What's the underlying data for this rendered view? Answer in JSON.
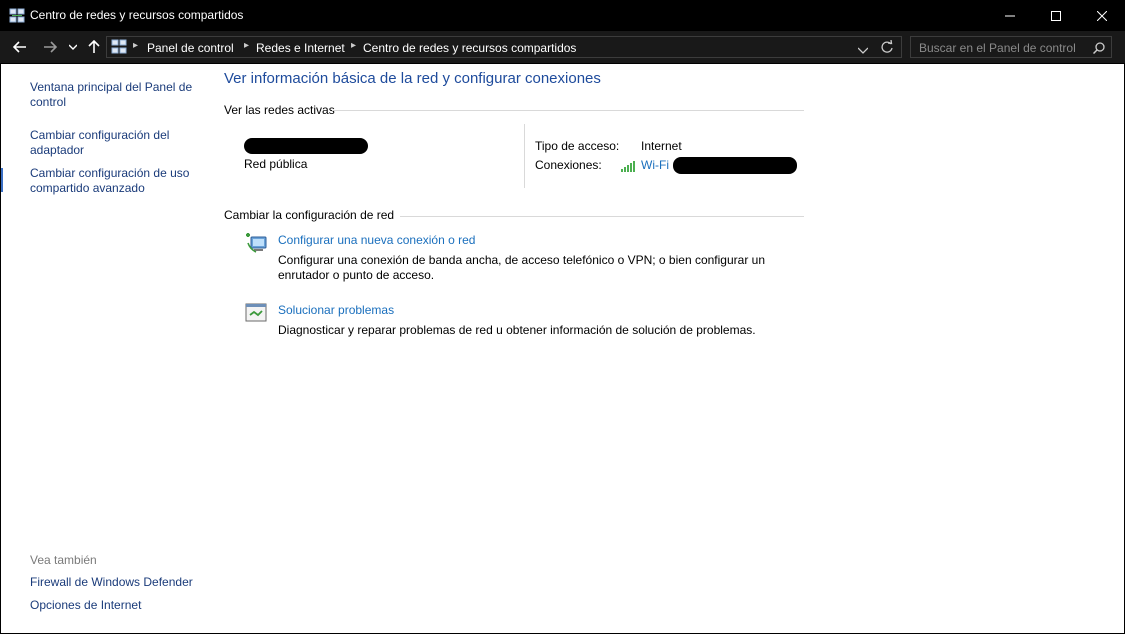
{
  "window": {
    "title": "Centro de redes y recursos compartidos"
  },
  "nav": {
    "breadcrumbs": [
      "Panel de control",
      "Redes e Internet",
      "Centro de redes y recursos compartidos"
    ],
    "search_placeholder": "Buscar en el Panel de control"
  },
  "sidebar": {
    "links": [
      "Ventana principal del Panel de control",
      "Cambiar configuración del adaptador",
      "Cambiar configuración de uso compartido avanzado"
    ],
    "see_also_label": "Vea también",
    "see_also_links": [
      "Firewall de Windows Defender",
      "Opciones de Internet"
    ]
  },
  "main": {
    "title": "Ver información básica de la red y configurar conexiones",
    "active_networks_heading": "Ver las redes activas",
    "network": {
      "type": "Red pública",
      "access_type_label": "Tipo de acceso:",
      "access_type_value": "Internet",
      "connections_label": "Conexiones:",
      "connection_name": "Wi-Fi"
    },
    "change_heading": "Cambiar la configuración de red",
    "tasks": [
      {
        "link": "Configurar una nueva conexión o red",
        "description": "Configurar una conexión de banda ancha, de acceso telefónico o VPN; o bien configurar un enrutador o punto de acceso."
      },
      {
        "link": "Solucionar problemas",
        "description": "Diagnosticar y reparar problemas de red u obtener información de solución de problemas."
      }
    ]
  },
  "colors": {
    "title_blue": "#1e4b9c",
    "link_blue": "#1a6fbd",
    "sidebar_link": "#1a3b7a",
    "chrome_bg": "#000000"
  }
}
